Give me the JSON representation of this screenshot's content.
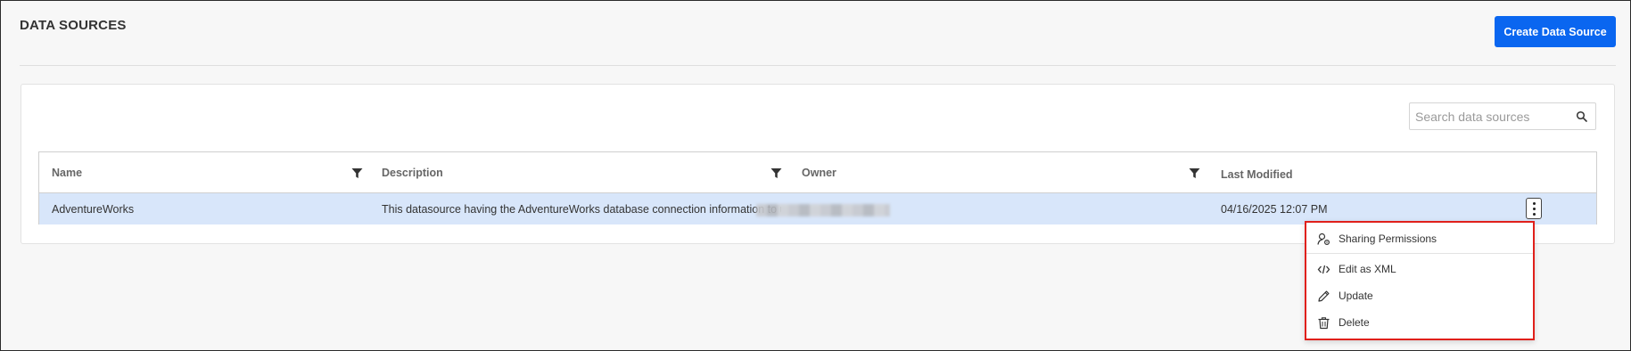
{
  "page": {
    "title": "DATA SOURCES",
    "create_button_label": "Create Data Source"
  },
  "search": {
    "placeholder": "Search data sources",
    "value": ""
  },
  "grid": {
    "columns": [
      {
        "label": "Name",
        "filterable": true
      },
      {
        "label": "Description",
        "filterable": true
      },
      {
        "label": "Owner",
        "filterable": true
      },
      {
        "label": "Last Modified",
        "filterable": false
      }
    ],
    "rows": [
      {
        "name": "AdventureWorks",
        "description": "This datasource having the AdventureWorks database connection information to u...",
        "owner": "",
        "last_modified": "04/16/2025 12:07 PM",
        "selected": true
      }
    ]
  },
  "context_menu": {
    "items": [
      {
        "label": "Sharing Permissions",
        "icon": "sharing-permissions-icon"
      },
      {
        "label": "Edit as XML",
        "icon": "code-icon"
      },
      {
        "label": "Update",
        "icon": "pencil-icon"
      },
      {
        "label": "Delete",
        "icon": "trash-icon"
      }
    ]
  },
  "colors": {
    "primary": "#0a66f0",
    "selected_row": "#d8e6fa",
    "highlight_border": "#e0201b",
    "background": "#f7f7f7"
  }
}
